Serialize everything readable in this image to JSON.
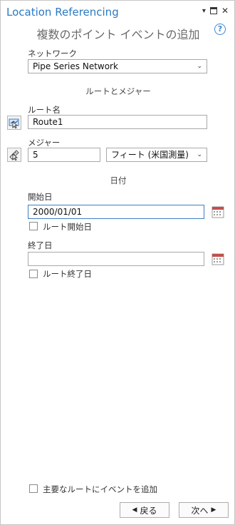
{
  "header": {
    "pane_title": "Location Referencing",
    "tool_title": "複数のポイント イベントの追加",
    "help_glyph": "?"
  },
  "network": {
    "label": "ネットワーク",
    "value": "Pipe Series Network"
  },
  "route_measure_section": {
    "title": "ルートとメジャー"
  },
  "route": {
    "label": "ルート名",
    "value": "Route1"
  },
  "measure": {
    "label": "メジャー",
    "value": "5",
    "unit": "フィート (米国測量)"
  },
  "date_section": {
    "title": "日付"
  },
  "start_date": {
    "label": "開始日",
    "value": "2000/01/01",
    "checkbox_label": "ルート開始日",
    "checked": false
  },
  "end_date": {
    "label": "終了日",
    "value": "",
    "checkbox_label": "ルート終了日",
    "checked": false
  },
  "footer": {
    "dominant_label": "主要なルートにイベントを追加",
    "back_label": "戻る",
    "next_label": "次へ"
  },
  "icons": {
    "pin": "pin-icon",
    "maximize": "maximize-icon",
    "close": "close-icon",
    "help": "help-icon",
    "route_pick": "select-route-from-map-icon",
    "measure_pick": "select-measure-from-map-icon",
    "calendar": "calendar-icon"
  },
  "colors": {
    "title_blue": "#2b7ac2",
    "active_border": "#3d7fbf",
    "calendar_accent": "#c0504d"
  }
}
